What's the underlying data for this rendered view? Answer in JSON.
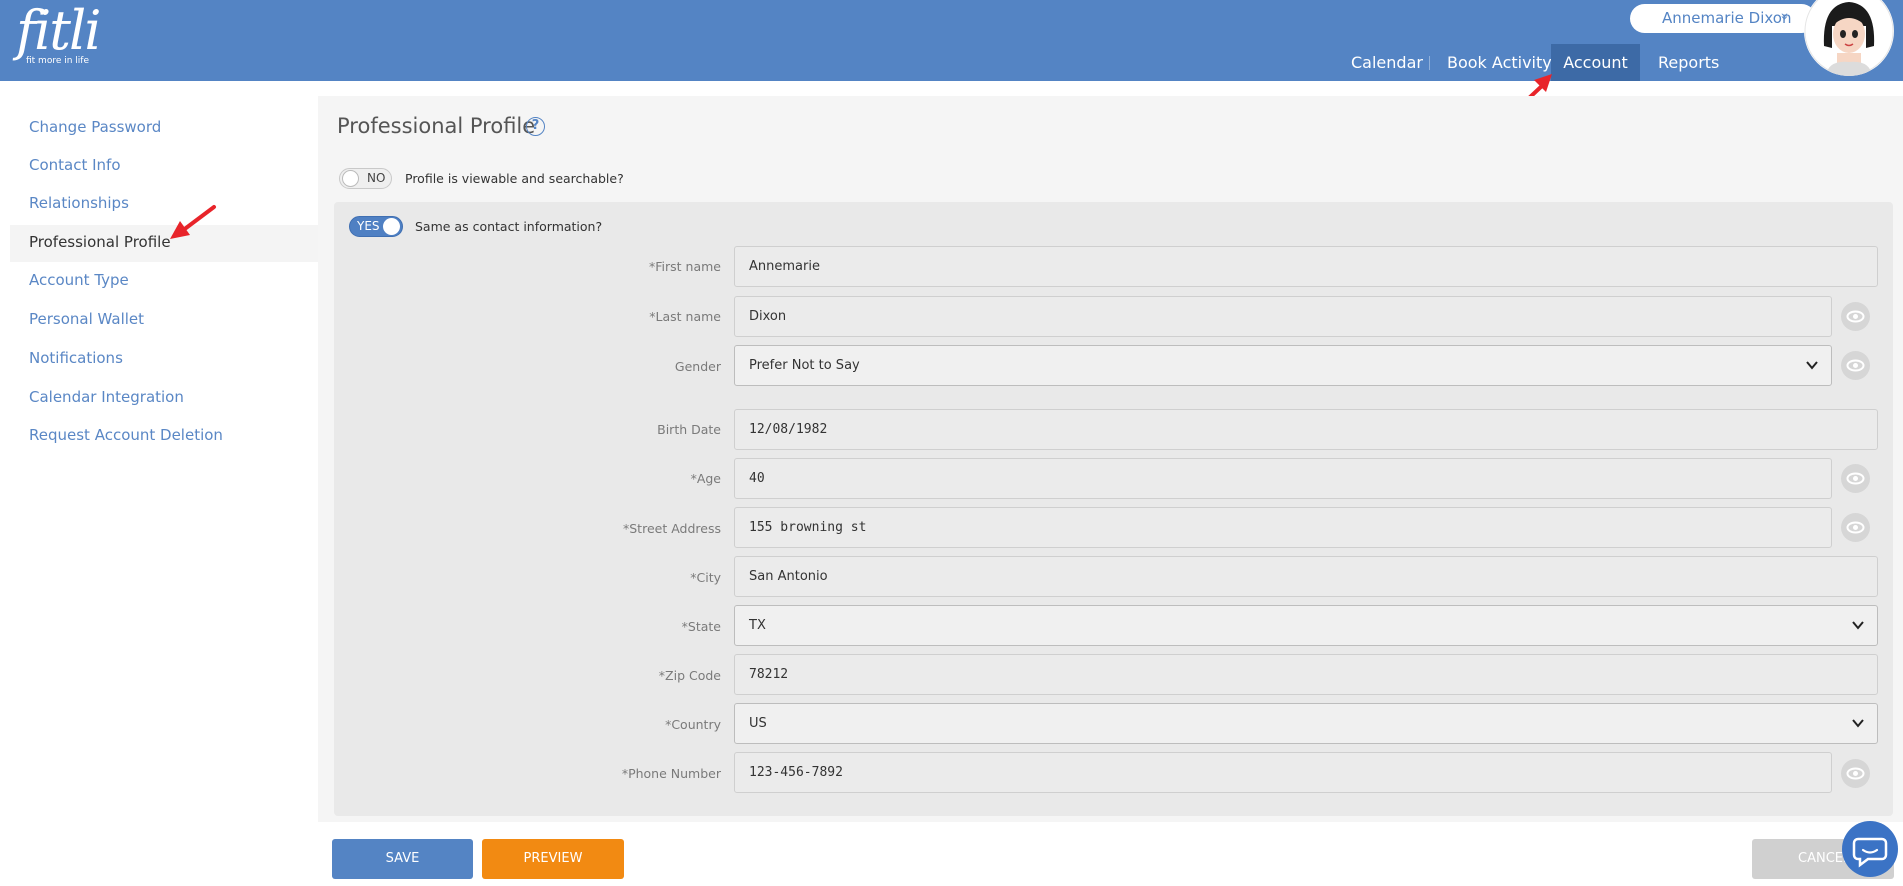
{
  "app": {
    "logo_text": "fitli",
    "logo_tagline": "fit more in life",
    "user_name": "Annemarie Dixon",
    "user_chevron": "»"
  },
  "nav": {
    "items": [
      {
        "label": "Calendar"
      },
      {
        "label": "Book Activity"
      },
      {
        "label": "Account"
      },
      {
        "label": "Reports"
      }
    ],
    "active": "Account"
  },
  "sidebar": {
    "items": [
      {
        "label": "Change Password"
      },
      {
        "label": "Contact Info"
      },
      {
        "label": "Relationships"
      },
      {
        "label": "Professional Profile"
      },
      {
        "label": "Account Type"
      },
      {
        "label": "Personal Wallet"
      },
      {
        "label": "Notifications"
      },
      {
        "label": "Calendar Integration"
      },
      {
        "label": "Request Account Deletion"
      }
    ],
    "active": "Professional Profile"
  },
  "main": {
    "title": "Professional Profile",
    "help_icon": "?",
    "viewable_toggle": {
      "state": "NO",
      "label": "Profile is viewable and searchable?"
    },
    "same_as_contact_toggle": {
      "state": "YES",
      "label": "Same as contact information?"
    },
    "fields": [
      {
        "label": "*First name",
        "value": "Annemarie"
      },
      {
        "label": "*Last name",
        "value": "Dixon"
      },
      {
        "label": "Gender",
        "value": "Prefer Not to Say"
      },
      {
        "label": "Birth Date",
        "value": "12/08/1982"
      },
      {
        "label": "*Age",
        "value": "40"
      },
      {
        "label": "*Street Address",
        "value": "155 browning st"
      },
      {
        "label": "*City",
        "value": "San Antonio"
      },
      {
        "label": "*State",
        "value": "TX"
      },
      {
        "label": "*Zip Code",
        "value": "78212"
      },
      {
        "label": "*Country",
        "value": "US"
      },
      {
        "label": "*Phone Number",
        "value": "123-456-7892"
      }
    ]
  },
  "footer": {
    "save_label": "SAVE",
    "preview_label": "PREVIEW",
    "cancel_label": "CANCEL"
  },
  "colors": {
    "header": "#5484c4",
    "nav_active": "#3d6aa6",
    "link": "#5a87c5",
    "preview": "#f28a12",
    "annotation_arrow": "#e8242a"
  },
  "icons": [
    "help-icon",
    "eye-icon",
    "chevron-down-icon",
    "chat-icon",
    "avatar"
  ]
}
